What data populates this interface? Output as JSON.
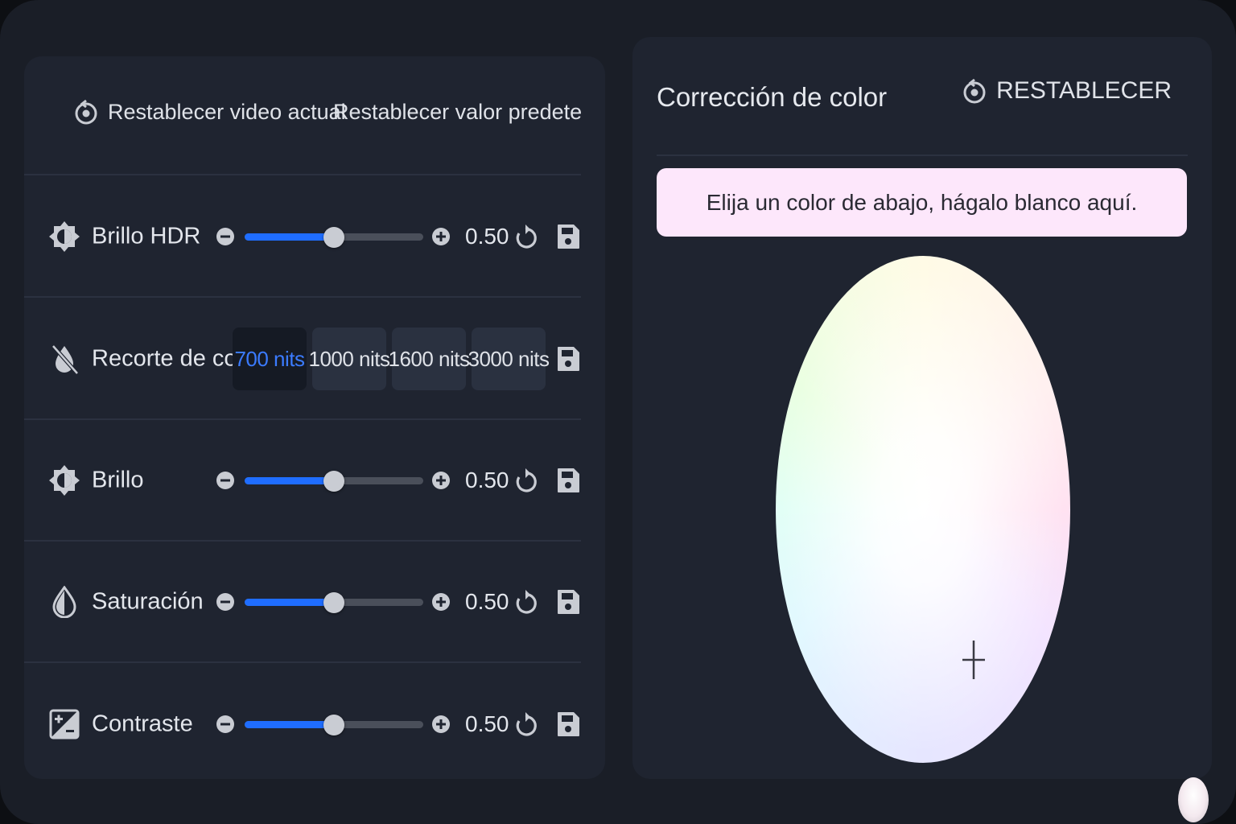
{
  "toolbar": {
    "reset_current_label": "Restablecer video actual",
    "reset_default_label": "Restablecer valor predeterminad"
  },
  "rows": [
    {
      "label": "Brillo HDR",
      "value_text": "0.50",
      "level": 0.5,
      "icon": "hdr-brightness-icon"
    },
    {
      "label": "Recorte de color",
      "icon": "color-clip-icon",
      "options": [
        "700 nits",
        "1000 nits",
        "1600 nits",
        "3000 nits"
      ],
      "selected": "700 nits"
    },
    {
      "label": "Brillo",
      "value_text": "0.50",
      "level": 0.5,
      "icon": "brightness-icon"
    },
    {
      "label": "Saturación",
      "value_text": "0.50",
      "level": 0.5,
      "icon": "saturation-drop-icon"
    },
    {
      "label": "Contraste",
      "value_text": "0.50",
      "level": 0.5,
      "icon": "contrast-icon"
    }
  ],
  "color_correction": {
    "title": "Corrección de color",
    "reset_label": "RESTABLECER",
    "hint": "Elija un color de abajo, hágalo blanco aquí."
  },
  "colors": {
    "accent": "#1f6dff",
    "active_text": "#3b7bff",
    "panel": "#1f2430",
    "hint_bg": "#fde7fb"
  }
}
